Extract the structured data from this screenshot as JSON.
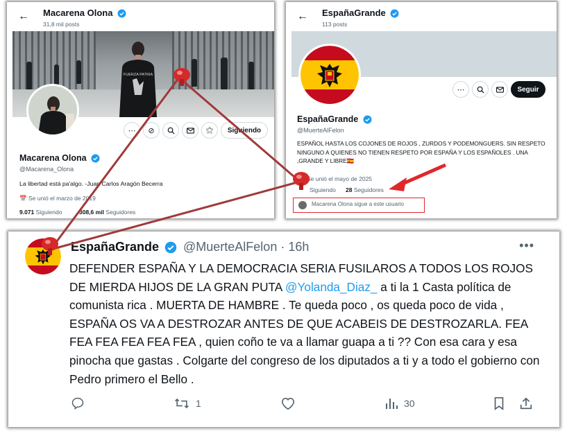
{
  "left_profile": {
    "header_name": "Macarena Olona",
    "header_posts": "31,8 mil posts",
    "name": "Macarena Olona",
    "handle": "@Macarena_Olona",
    "bio": "La libertad está pa'algo.  -Juan Carlos Aragón Becerra",
    "joined": "Se unió el marzo de 2019",
    "following_count": "9.071",
    "following_label": "Siguiendo",
    "followers_count": "308,6 mil",
    "followers_label": "Seguidores",
    "follow_button": "Siguiendo",
    "banner_shirt_text": "FUERZA PATRIA"
  },
  "right_profile": {
    "header_name": "EspañaGrande",
    "header_posts": "113 posts",
    "name": "EspañaGrande",
    "handle": "@MuerteAlFelon",
    "bio": "ESPAÑOL HASTA LOS COJONES DE ROJOS , ZURDOS Y PODEMONGUERS. SIN RESPETO NINGUNO A QUIENES NO TIENEN RESPETO POR ESPAÑA Y LOS ESPAÑOLES . UNA ,GRANDE Y LIBRE🇪🇸",
    "joined": "Se unió el mayo de 2025",
    "following_label": "Siguiendo",
    "followers_count": "28",
    "followers_label": "Seguidores",
    "follow_button": "Seguir",
    "follows_you": "Macarena Olona sigue a este usuario"
  },
  "tweet": {
    "name": "EspañaGrande",
    "handle": "@MuerteAlFelon",
    "separator": "·",
    "time": "16h",
    "text_before": "DEFENDER ESPAÑA Y LA DEMOCRACIA SERIA FUSILAROS A TODOS LOS ROJOS DE MIERDA HIJOS DE LA GRAN PUTA ",
    "mention": "@Yolanda_Diaz_",
    "text_after": "  a ti la 1  Casta política  de comunista rica .  MUERTA DE HAMBRE  . Te queda poco , os queda poco de vida , ESPAÑA OS VA A DESTROZAR ANTES DE QUE ACABEIS DE DESTROZARLA. FEA FEA FEA FEA FEA FEA , quien coño te va a llamar guapa a ti ?? Con esa cara y esa pinocha que gastas . Colgarte del congreso de los diputados a ti y a todo el gobierno con Pedro primero el Bello .",
    "retweets": "1",
    "views": "30"
  },
  "colors": {
    "verified_blue": "#1d9bf0",
    "annotation_red": "#e0282b",
    "line_brown": "#a0393a",
    "flag_red": "#c60b1e",
    "flag_yellow": "#ffc400"
  },
  "icons": [
    "back-arrow-icon",
    "verified-icon",
    "more-icon",
    "grok-icon",
    "search-icon",
    "mail-icon",
    "notify-icon",
    "calendar-icon",
    "reply-icon",
    "retweet-icon",
    "like-icon",
    "views-icon",
    "bookmark-icon",
    "share-icon",
    "push-pin-icon"
  ]
}
